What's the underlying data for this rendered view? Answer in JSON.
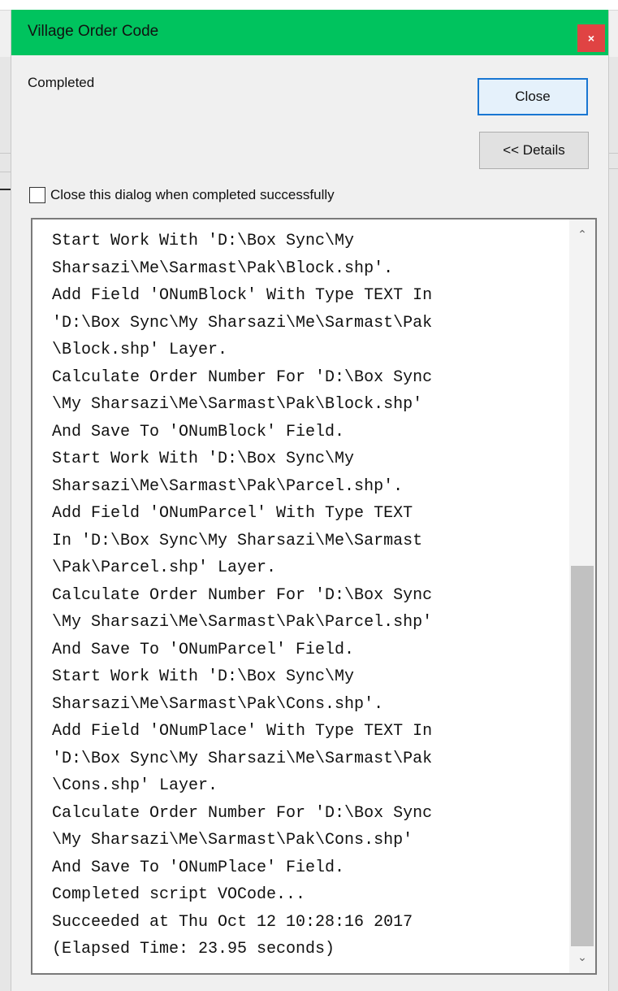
{
  "dialog": {
    "title": "Village Order Code",
    "close_glyph": "×",
    "status": "Completed",
    "close_button": "Close",
    "details_button": "<< Details",
    "auto_close_checkbox": {
      "label": "Close this dialog when completed successfully",
      "checked": false
    }
  },
  "log": {
    "lines": [
      "Start Work With 'D:\\Box Sync\\My",
      "Sharsazi\\Me\\Sarmast\\Pak\\Block.shp'.",
      "Add Field 'ONumBlock' With Type TEXT In",
      "'D:\\Box Sync\\My Sharsazi\\Me\\Sarmast\\Pak",
      "\\Block.shp' Layer.",
      "Calculate Order Number For 'D:\\Box Sync",
      "\\My Sharsazi\\Me\\Sarmast\\Pak\\Block.shp'",
      "And Save To 'ONumBlock' Field.",
      "Start Work With 'D:\\Box Sync\\My",
      "Sharsazi\\Me\\Sarmast\\Pak\\Parcel.shp'.",
      "Add Field 'ONumParcel' With Type TEXT",
      "In 'D:\\Box Sync\\My Sharsazi\\Me\\Sarmast",
      "\\Pak\\Parcel.shp' Layer.",
      "Calculate Order Number For 'D:\\Box Sync",
      "\\My Sharsazi\\Me\\Sarmast\\Pak\\Parcel.shp'",
      "And Save To 'ONumParcel' Field.",
      "Start Work With 'D:\\Box Sync\\My",
      "Sharsazi\\Me\\Sarmast\\Pak\\Cons.shp'.",
      "Add Field 'ONumPlace' With Type TEXT In",
      "'D:\\Box Sync\\My Sharsazi\\Me\\Sarmast\\Pak",
      "\\Cons.shp' Layer.",
      "Calculate Order Number For 'D:\\Box Sync",
      "\\My Sharsazi\\Me\\Sarmast\\Pak\\Cons.shp'",
      "And Save To 'ONumPlace' Field.",
      "Completed script VOCode...",
      "Succeeded at Thu Oct 12 10:28:16 2017",
      "(Elapsed Time: 23.95 seconds)"
    ],
    "scroll_up_glyph": "⌃",
    "scroll_down_glyph": "⌄"
  },
  "colors": {
    "titlebar": "#00c35e",
    "close_button_bg": "#e04343",
    "focus_border": "#1976d2"
  },
  "icons": {
    "close": "close-icon",
    "scroll_up": "chevron-up-icon",
    "scroll_down": "chevron-down-icon"
  }
}
